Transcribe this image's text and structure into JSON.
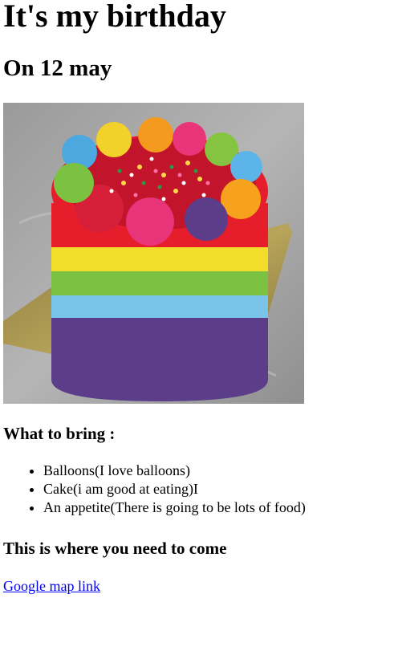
{
  "header": {
    "title": "It's my birthday",
    "subtitle": "On 12 may"
  },
  "image": {
    "name": "rainbow-cake-image"
  },
  "bring": {
    "heading": "What to bring :",
    "items": [
      {
        "label": "Balloons(I love balloons)"
      },
      {
        "label": "Cake(i am good at eating)I"
      },
      {
        "label": "An appetite(There is going to be lots of food)"
      }
    ]
  },
  "location": {
    "heading": "This is where you need to come",
    "link_text": "Google map link"
  }
}
